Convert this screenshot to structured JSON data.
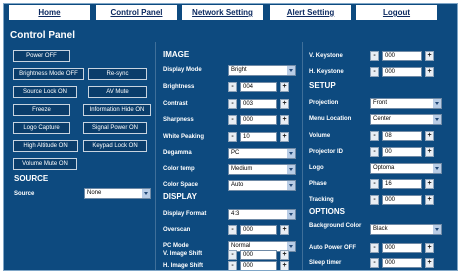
{
  "nav": [
    "Home",
    "Control Panel",
    "Network Setting",
    "Alert Setting",
    "Logout"
  ],
  "title": "Control Panel",
  "buttons": [
    "Power OFF",
    "Brightness Mode OFF",
    "Re-sync",
    "Source Lock ON",
    "AV Mute",
    "Freeze",
    "Information Hide ON",
    "Logo Capture",
    "Signal Power ON",
    "High Altitude ON",
    "Keypad Lock ON",
    "Volume Mute ON"
  ],
  "source": {
    "title": "SOURCE",
    "label": "Source",
    "value": "None"
  },
  "image": {
    "title": "IMAGE",
    "display_mode": {
      "label": "Display Mode",
      "value": "Bright"
    },
    "brightness": {
      "label": "Brightness",
      "value": "004"
    },
    "contrast": {
      "label": "Contrast",
      "value": "003"
    },
    "sharpness": {
      "label": "Sharpness",
      "value": "000"
    },
    "white_peaking": {
      "label": "White Peaking",
      "value": "10"
    },
    "degamma": {
      "label": "Degamma",
      "value": "PC"
    },
    "color_temp": {
      "label": "Color temp",
      "value": "Medium"
    },
    "color_space": {
      "label": "Color Space",
      "value": "Auto"
    }
  },
  "display": {
    "title": "DISPLAY",
    "display_format": {
      "label": "Display Format",
      "value": "4:3"
    },
    "overscan": {
      "label": "Overscan",
      "value": "000"
    },
    "pc_mode": {
      "label": "PC Mode",
      "value": "Normal"
    },
    "v_image_shift": {
      "label": "V. Image Shift",
      "value": "000"
    },
    "h_image_shift": {
      "label": "H. Image Shift",
      "value": "000"
    }
  },
  "keystone": {
    "v": {
      "label": "V. Keystone",
      "value": "000"
    },
    "h": {
      "label": "H. Keystone",
      "value": "000"
    }
  },
  "setup": {
    "title": "SETUP",
    "projection": {
      "label": "Projection",
      "value": "Front"
    },
    "menu_location": {
      "label": "Menu Location",
      "value": "Center"
    },
    "volume": {
      "label": "Volume",
      "value": "08"
    },
    "projector_id": {
      "label": "Projector ID",
      "value": "00"
    },
    "logo": {
      "label": "Logo",
      "value": "Optoma"
    },
    "phase": {
      "label": "Phase",
      "value": "16"
    },
    "tracking": {
      "label": "Tracking",
      "value": "000"
    }
  },
  "options": {
    "title": "OPTIONS",
    "background_color": {
      "label": "Background Color",
      "value": "Black"
    },
    "auto_power_off": {
      "label": "Auto Power OFF",
      "value": "000"
    },
    "sleep_timer": {
      "label": "Sleep timer",
      "value": "000"
    }
  },
  "symbols": {
    "minus": "-",
    "plus": "+"
  }
}
